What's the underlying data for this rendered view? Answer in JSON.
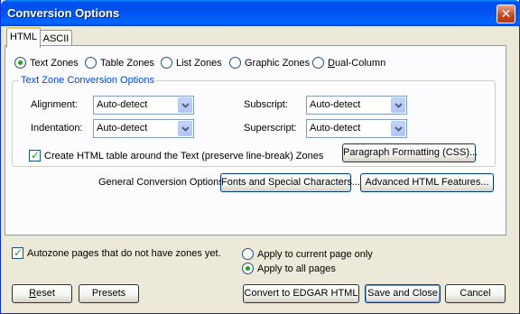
{
  "window": {
    "title": "Conversion Options",
    "close_glyph": "✕"
  },
  "tabs": [
    {
      "label": "HTML",
      "active": true
    },
    {
      "label": "ASCII",
      "active": false
    }
  ],
  "zone_types": [
    {
      "label": "Text Zones",
      "selected": true,
      "underline": ""
    },
    {
      "label": "Table Zones",
      "selected": false,
      "underline": ""
    },
    {
      "label": "List Zones",
      "selected": false,
      "underline": ""
    },
    {
      "label": "Graphic Zones",
      "selected": false,
      "underline": ""
    },
    {
      "label_prefix": "",
      "label_underline": "D",
      "label_rest": "ual-Column",
      "selected": false
    }
  ],
  "text_zone_group": {
    "title": "Text Zone Conversion Options",
    "alignment": {
      "label": "Alignment:",
      "value": "Auto-detect"
    },
    "indentation": {
      "label": "Indentation:",
      "value": "Auto-detect"
    },
    "subscript": {
      "label": "Subscript:",
      "value": "Auto-detect"
    },
    "superscript": {
      "label": "Superscript:",
      "value": "Auto-detect"
    },
    "create_table": {
      "label": "Create HTML table around the Text (preserve line-break) Zones",
      "checked": true
    },
    "paragraph_button": "Paragraph Formatting (CSS)..."
  },
  "general": {
    "label": "General Conversion Options:",
    "fonts_button": "Fonts and Special Characters...",
    "advanced_button": "Advanced HTML Features..."
  },
  "autozone": {
    "label": "Autozone pages that do not have zones yet.",
    "checked": true
  },
  "apply_scope": [
    {
      "label": "Apply to current page only",
      "selected": false
    },
    {
      "label": "Apply to all pages",
      "selected": true
    }
  ],
  "footer": {
    "reset_u": "R",
    "reset_rest": "eset",
    "presets": "Presets",
    "convert": "Convert to EDGAR HTML",
    "save_close": "Save and Close",
    "cancel": "Cancel"
  },
  "colors": {
    "title_bar": "#0054E3",
    "accent_check": "#21A121",
    "group_title": "#0046D5",
    "dialog_bg": "#ECE9D8"
  }
}
